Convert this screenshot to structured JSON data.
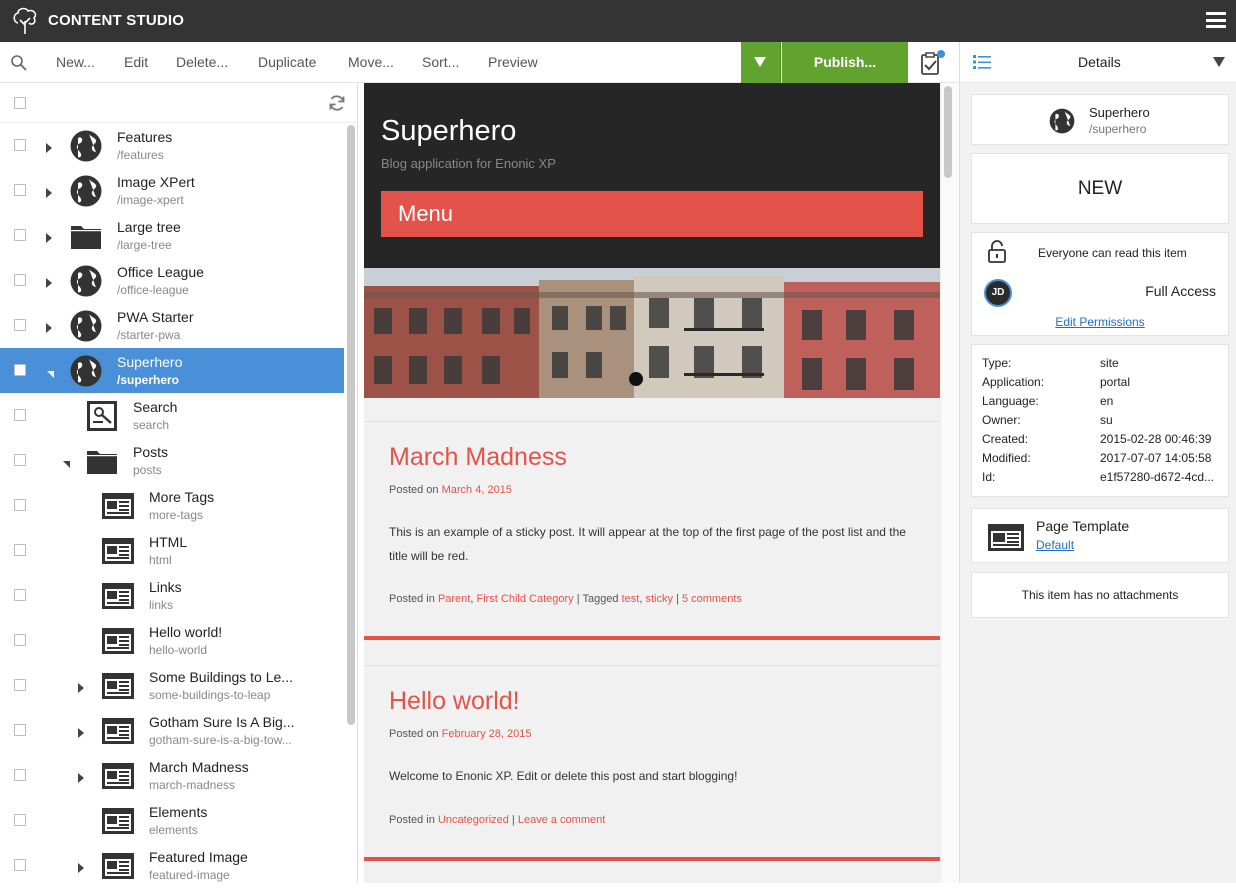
{
  "app": {
    "title": "CONTENT STUDIO"
  },
  "toolbar": {
    "new": "New...",
    "edit": "Edit",
    "delete": "Delete...",
    "duplicate": "Duplicate",
    "move": "Move...",
    "sort": "Sort...",
    "preview": "Preview",
    "publish": "Publish...",
    "accent": "#62a32f"
  },
  "tree": {
    "items": [
      {
        "name": "Features",
        "path": "/features",
        "icon": "globe-icon"
      },
      {
        "name": "Image XPert",
        "path": "/image-xpert",
        "icon": "globe-icon"
      },
      {
        "name": "Large tree",
        "path": "/large-tree",
        "icon": "folder-icon"
      },
      {
        "name": "Office League",
        "path": "/office-league",
        "icon": "globe-icon"
      },
      {
        "name": "PWA Starter",
        "path": "/starter-pwa",
        "icon": "globe-icon"
      },
      {
        "name": "Superhero",
        "path": "/superhero",
        "icon": "globe-icon",
        "selected": true
      },
      {
        "name": "Search",
        "path": "search",
        "icon": "search-page-icon"
      },
      {
        "name": "Posts",
        "path": "posts",
        "icon": "folder-icon"
      },
      {
        "name": "More Tags",
        "path": "more-tags",
        "icon": "article-icon"
      },
      {
        "name": "HTML",
        "path": "html",
        "icon": "article-icon"
      },
      {
        "name": "Links",
        "path": "links",
        "icon": "article-icon"
      },
      {
        "name": "Hello world!",
        "path": "hello-world",
        "icon": "article-icon"
      },
      {
        "name": "Some Buildings to Le...",
        "path": "some-buildings-to-leap",
        "icon": "article-icon"
      },
      {
        "name": "Gotham Sure Is A Big...",
        "path": "gotham-sure-is-a-big-tow...",
        "icon": "article-icon"
      },
      {
        "name": "March Madness",
        "path": "march-madness",
        "icon": "article-icon"
      },
      {
        "name": "Elements",
        "path": "elements",
        "icon": "article-icon"
      },
      {
        "name": "Featured Image",
        "path": "featured-image",
        "icon": "article-icon"
      }
    ]
  },
  "preview": {
    "site_title": "Superhero",
    "site_subtitle": "Blog application for Enonic XP",
    "menu": "Menu",
    "accent": "#e4534a",
    "posts": [
      {
        "title": "March Madness",
        "posted_on": "Posted on",
        "date": "March 4, 2015",
        "excerpt": "This is an example of a sticky post. It will appear at the top of the first page of the post list and the title will be red.",
        "posted_in": "Posted in",
        "cat1": "Parent",
        "cat2": "First Child Category",
        "tagged": "| Tagged",
        "tag1": "test",
        "tag2": "sticky",
        "comments": "5 comments"
      },
      {
        "title": "Hello world!",
        "posted_on": "Posted on",
        "date": "February 28, 2015",
        "excerpt": "Welcome to Enonic XP. Edit or delete this post and start blogging!",
        "posted_in": "Posted in",
        "cat1": "Uncategorized",
        "comments": "Leave a comment"
      }
    ]
  },
  "details": {
    "header": "Details",
    "item_name": "Superhero",
    "item_path": "/superhero",
    "status": "NEW",
    "access_everyone": "Everyone can read this item",
    "avatar_initials": "JD",
    "access_level": "Full Access",
    "edit_permissions": "Edit Permissions",
    "props": [
      {
        "k": "Type:",
        "v": "site"
      },
      {
        "k": "Application:",
        "v": "portal"
      },
      {
        "k": "Language:",
        "v": "en"
      },
      {
        "k": "Owner:",
        "v": "su"
      },
      {
        "k": "Created:",
        "v": "2015-02-28 00:46:39"
      },
      {
        "k": "Modified:",
        "v": "2017-07-07 14:05:58"
      },
      {
        "k": "Id:",
        "v": "e1f57280-d672-4cd..."
      }
    ],
    "page_template_label": "Page Template",
    "page_template_value": "Default",
    "attachments": "This item has no attachments"
  }
}
